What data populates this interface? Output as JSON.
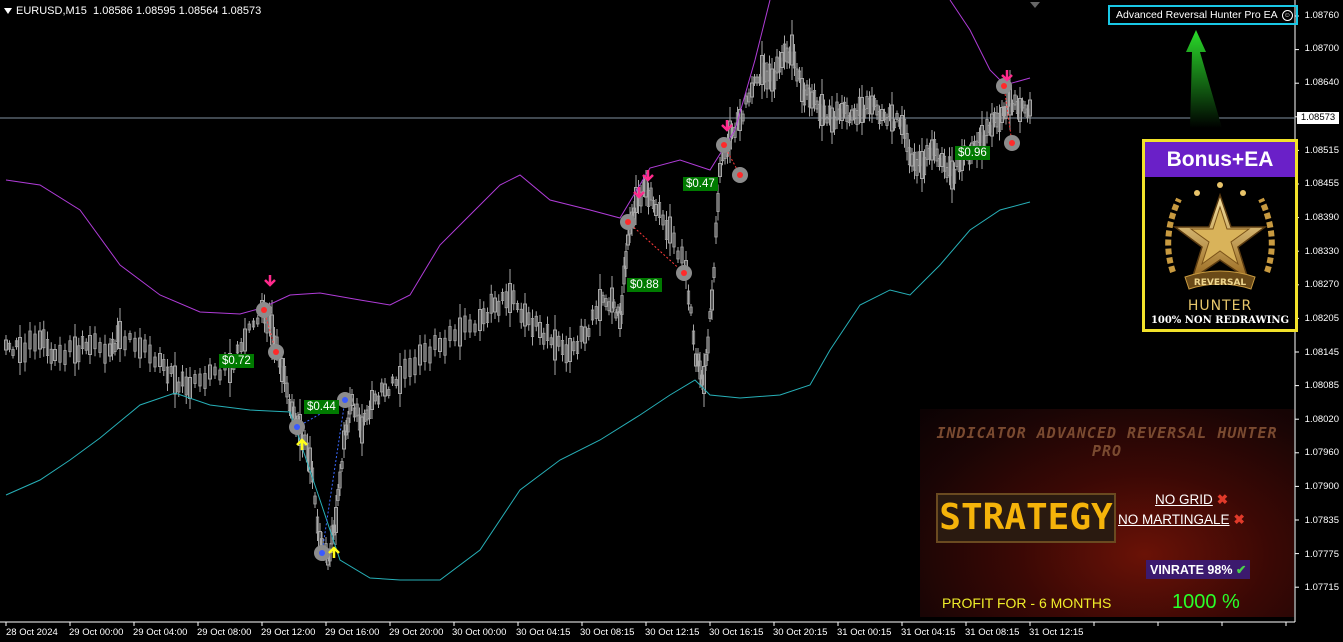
{
  "header": {
    "symbol": "EURUSD,M15",
    "ohlc": "1.08586 1.08595 1.08564 1.08573"
  },
  "ea_badge": {
    "label": "Advanced Reversal Hunter Pro EA"
  },
  "price_axis": {
    "labels": [
      "1.08760",
      "1.08700",
      "1.08640",
      "1.08573",
      "1.08515",
      "1.08455",
      "1.08390",
      "1.08330",
      "1.08270",
      "1.08205",
      "1.08145",
      "1.08085",
      "1.08020",
      "1.07960",
      "1.07900",
      "1.07835",
      "1.07775",
      "1.07715"
    ],
    "current": "1.08573"
  },
  "time_axis": {
    "labels": [
      "28 Oct 2024",
      "29 Oct 00:00",
      "29 Oct 04:00",
      "29 Oct 08:00",
      "29 Oct 12:00",
      "29 Oct 16:00",
      "29 Oct 20:00",
      "30 Oct 00:00",
      "30 Oct 04:15",
      "30 Oct 08:15",
      "30 Oct 12:15",
      "30 Oct 16:15",
      "30 Oct 20:15",
      "31 Oct 00:15",
      "31 Oct 04:15",
      "31 Oct 08:15",
      "31 Oct 12:15"
    ]
  },
  "trades": [
    {
      "profit": "$0.72"
    },
    {
      "profit": "$0.44"
    },
    {
      "profit": "$0.88"
    },
    {
      "profit": "$0.47"
    },
    {
      "profit": "$0.96"
    }
  ],
  "bonus_box": {
    "title": "Bonus+EA",
    "emblem_text": "REVERSAL",
    "hunter": "HUNTER",
    "tagline": "100% NON REDRAWING"
  },
  "banner": {
    "title": "INDICATOR ADVANCED REVERSAL HUNTER PRO",
    "strategy": "STRATEGY",
    "no_grid": "NO GRID",
    "no_martingale": "NO MARTINGALE",
    "winrate": "VINRATE 98%",
    "profit_for": "PROFIT FOR - 6 MONTHS",
    "percent": "1000 %"
  },
  "colors": {
    "background": "#000000",
    "candles": "#a6a6a6",
    "upper_band": "#b03cd8",
    "lower_band": "#27b0b8",
    "sell_arrow": "#ff2a8c",
    "buy_arrow": "#ffff1a",
    "profit_label": "#007a00",
    "ea_badge_border": "#19c8e6"
  },
  "icons": [
    "dropdown-triangle-icon",
    "smiley-icon",
    "sell-arrow-icon",
    "buy-arrow-icon",
    "reversal-dot-icon",
    "star-emblem-icon",
    "check-icon",
    "cross-icon"
  ]
}
